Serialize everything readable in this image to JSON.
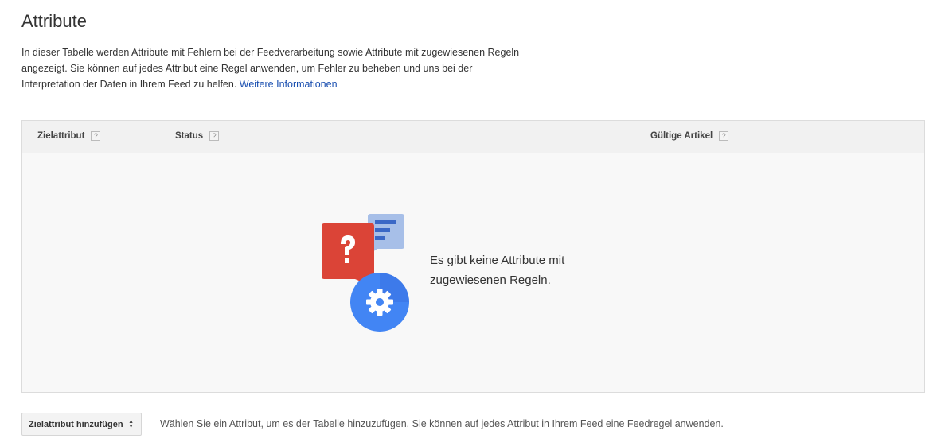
{
  "page": {
    "title": "Attribute",
    "description": "In dieser Tabelle werden Attribute mit Fehlern bei der Feedverarbeitung sowie Attribute mit zugewiesenen Regeln angezeigt. Sie können auf jedes Attribut eine Regel anwenden, um Fehler zu beheben und uns bei der Interpretation der Daten in Ihrem Feed zu helfen.",
    "more_link": "Weitere Informationen"
  },
  "table": {
    "columns": [
      {
        "label": "Zielattribut",
        "help": "?"
      },
      {
        "label": "Status",
        "help": "?"
      },
      {
        "label": "Gültige Artikel",
        "help": "?"
      }
    ],
    "empty_line1": "Es gibt keine Attribute mit",
    "empty_line2": "zugewiesenen Regeln."
  },
  "footer": {
    "add_button_label": "Zielattribut hinzufügen",
    "hint": "Wählen Sie ein Attribut, um es der Tabelle hinzuzufügen. Sie können auf jedes Attribut in Ihrem Feed eine Feedregel anwenden."
  },
  "icons": {
    "help": "help-icon",
    "question_bubble": "question-bubble-icon",
    "document_bubble": "document-bubble-icon",
    "gear": "gear-icon",
    "sort_arrows": "sort-arrows-icon"
  },
  "colors": {
    "link": "#1a4fb0",
    "red_bubble": "#db4437",
    "blue_bubble": "#a7bfe8",
    "gear_circle": "#4285f4"
  }
}
